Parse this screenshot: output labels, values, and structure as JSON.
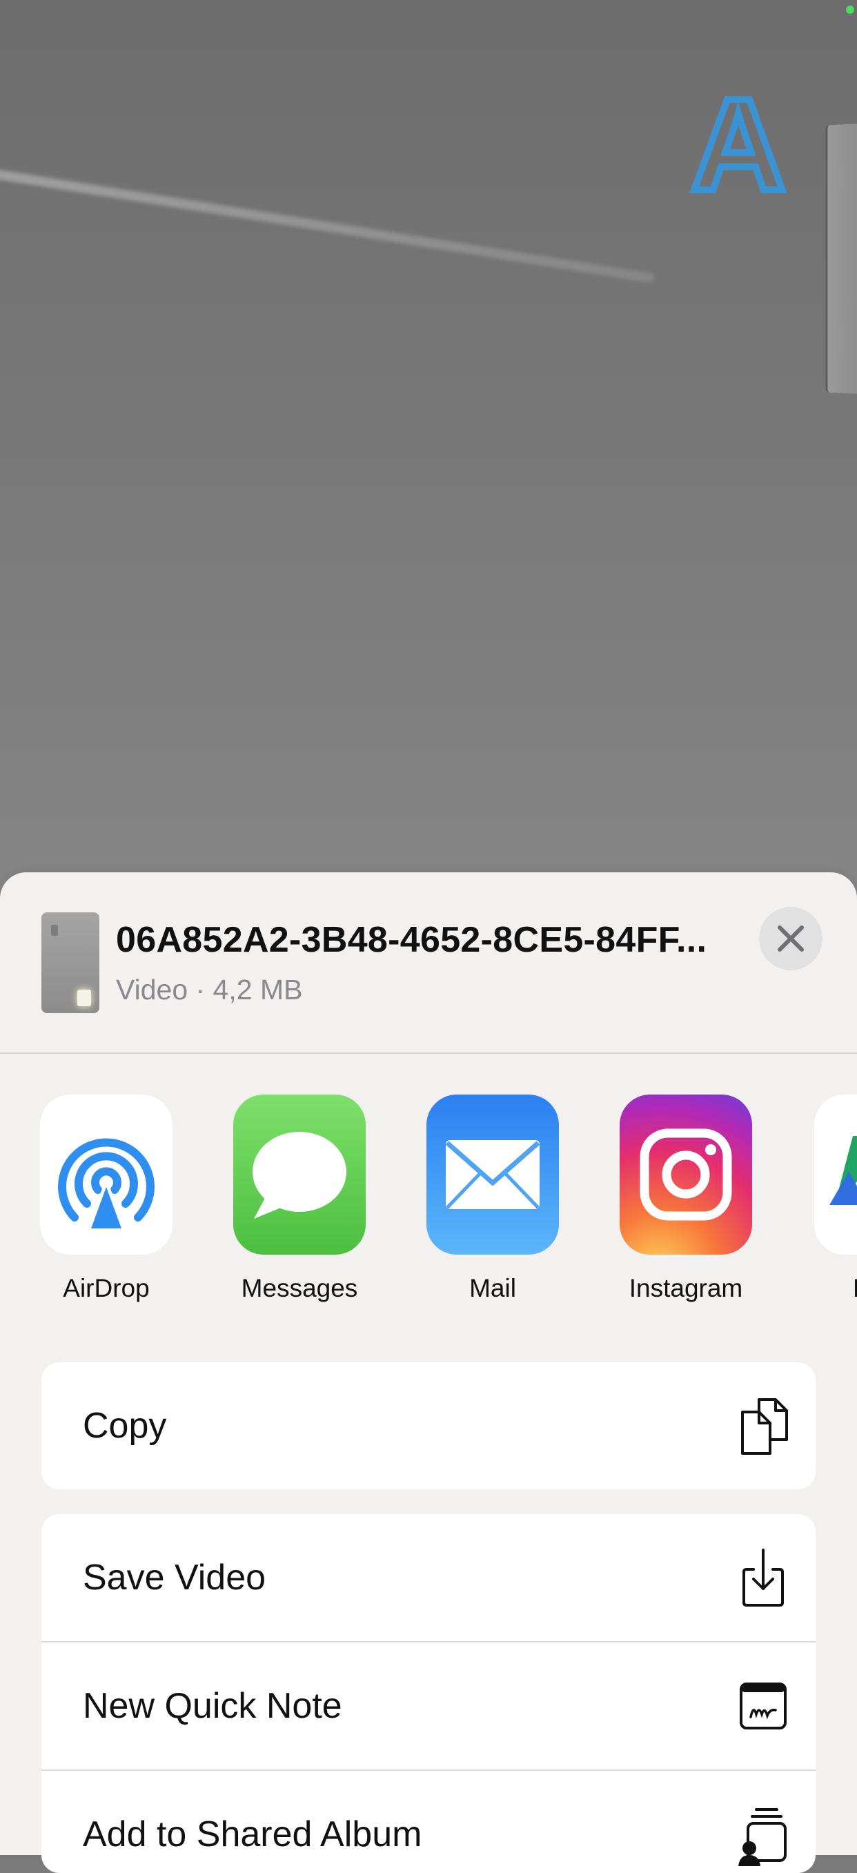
{
  "share_sheet": {
    "file_title": "06A852A2-3B48-4652-8CE5-84FF...",
    "file_meta": "Video · 4,2 MB"
  },
  "overlay_letter": "A",
  "apps": [
    {
      "label": "AirDrop",
      "icon": "airdrop-icon"
    },
    {
      "label": "Messages",
      "icon": "messages-icon"
    },
    {
      "label": "Mail",
      "icon": "mail-icon"
    },
    {
      "label": "Instagram",
      "icon": "instagram-icon"
    },
    {
      "label": "D",
      "icon": "drive-icon"
    }
  ],
  "actions": [
    {
      "label": "Copy",
      "icon": "copy-icon"
    },
    {
      "label": "Save Video",
      "icon": "save-icon"
    },
    {
      "label": "New Quick Note",
      "icon": "quick-note-icon"
    },
    {
      "label": "Add to Shared Album",
      "icon": "shared-album-icon"
    }
  ],
  "colors": {
    "sheet_background": "#f2f1f0",
    "airdrop_blue": "#2f8ff0",
    "messages_green": "#5ec94f",
    "mail_blue": "#3d9af2",
    "overlay_letter": "#3b93d4"
  }
}
